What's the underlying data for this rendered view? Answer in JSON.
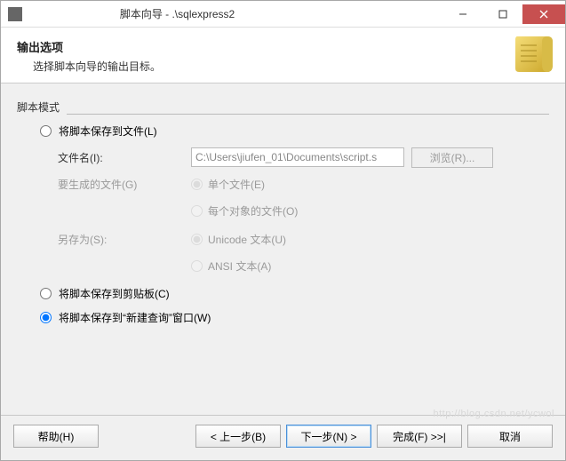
{
  "titlebar": {
    "title": "脚本向导 - .\\sqlexpress2"
  },
  "header": {
    "title": "输出选项",
    "subtitle": "选择脚本向导的输出目标。"
  },
  "group": {
    "label": "脚本模式"
  },
  "options": {
    "save_file": "将脚本保存到文件(L)",
    "save_clipboard": "将脚本保存到剪贴板(C)",
    "save_newquery": "将脚本保存到“新建查询”窗口(W)"
  },
  "file_section": {
    "filename_label": "文件名(I):",
    "filename_value": "C:\\Users\\jiufen_01\\Documents\\script.s",
    "browse": "浏览(R)...",
    "generate_label": "要生成的文件(G)",
    "single_file": "单个文件(E)",
    "per_object": "每个对象的文件(O)",
    "saveas_label": "另存为(S):",
    "unicode": "Unicode 文本(U)",
    "ansi": "ANSI 文本(A)"
  },
  "footer": {
    "help": "帮助(H)",
    "back": "< 上一步(B)",
    "next": "下一步(N) >",
    "finish": "完成(F) >>|",
    "cancel": "取消"
  },
  "watermark": "http://blog.csdn.net/ycwol"
}
